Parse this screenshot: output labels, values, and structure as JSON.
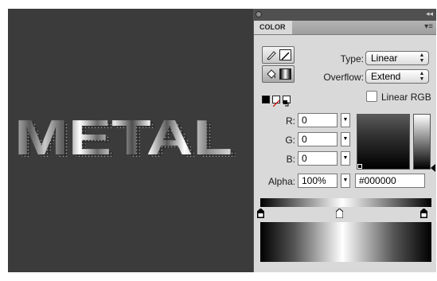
{
  "canvas": {
    "text": "METAL",
    "background": "#3b3b3b"
  },
  "panel": {
    "title": "COLOR",
    "menu_icon": "panel-menu-icon",
    "collapse_icon": "collapse-double-arrow-icon",
    "type_label": "Type:",
    "type_value": "Linear",
    "overflow_label": "Overflow:",
    "overflow_value": "Extend",
    "linear_rgb_label": "Linear RGB",
    "linear_rgb_checked": false,
    "r_label": "R:",
    "r_value": "0",
    "g_label": "G:",
    "g_value": "0",
    "b_label": "B:",
    "b_value": "0",
    "alpha_label": "Alpha:",
    "alpha_value": "100%",
    "hex_value": "#000000",
    "gradient_stops": [
      "#000000",
      "#ffffff",
      "#000000"
    ]
  }
}
